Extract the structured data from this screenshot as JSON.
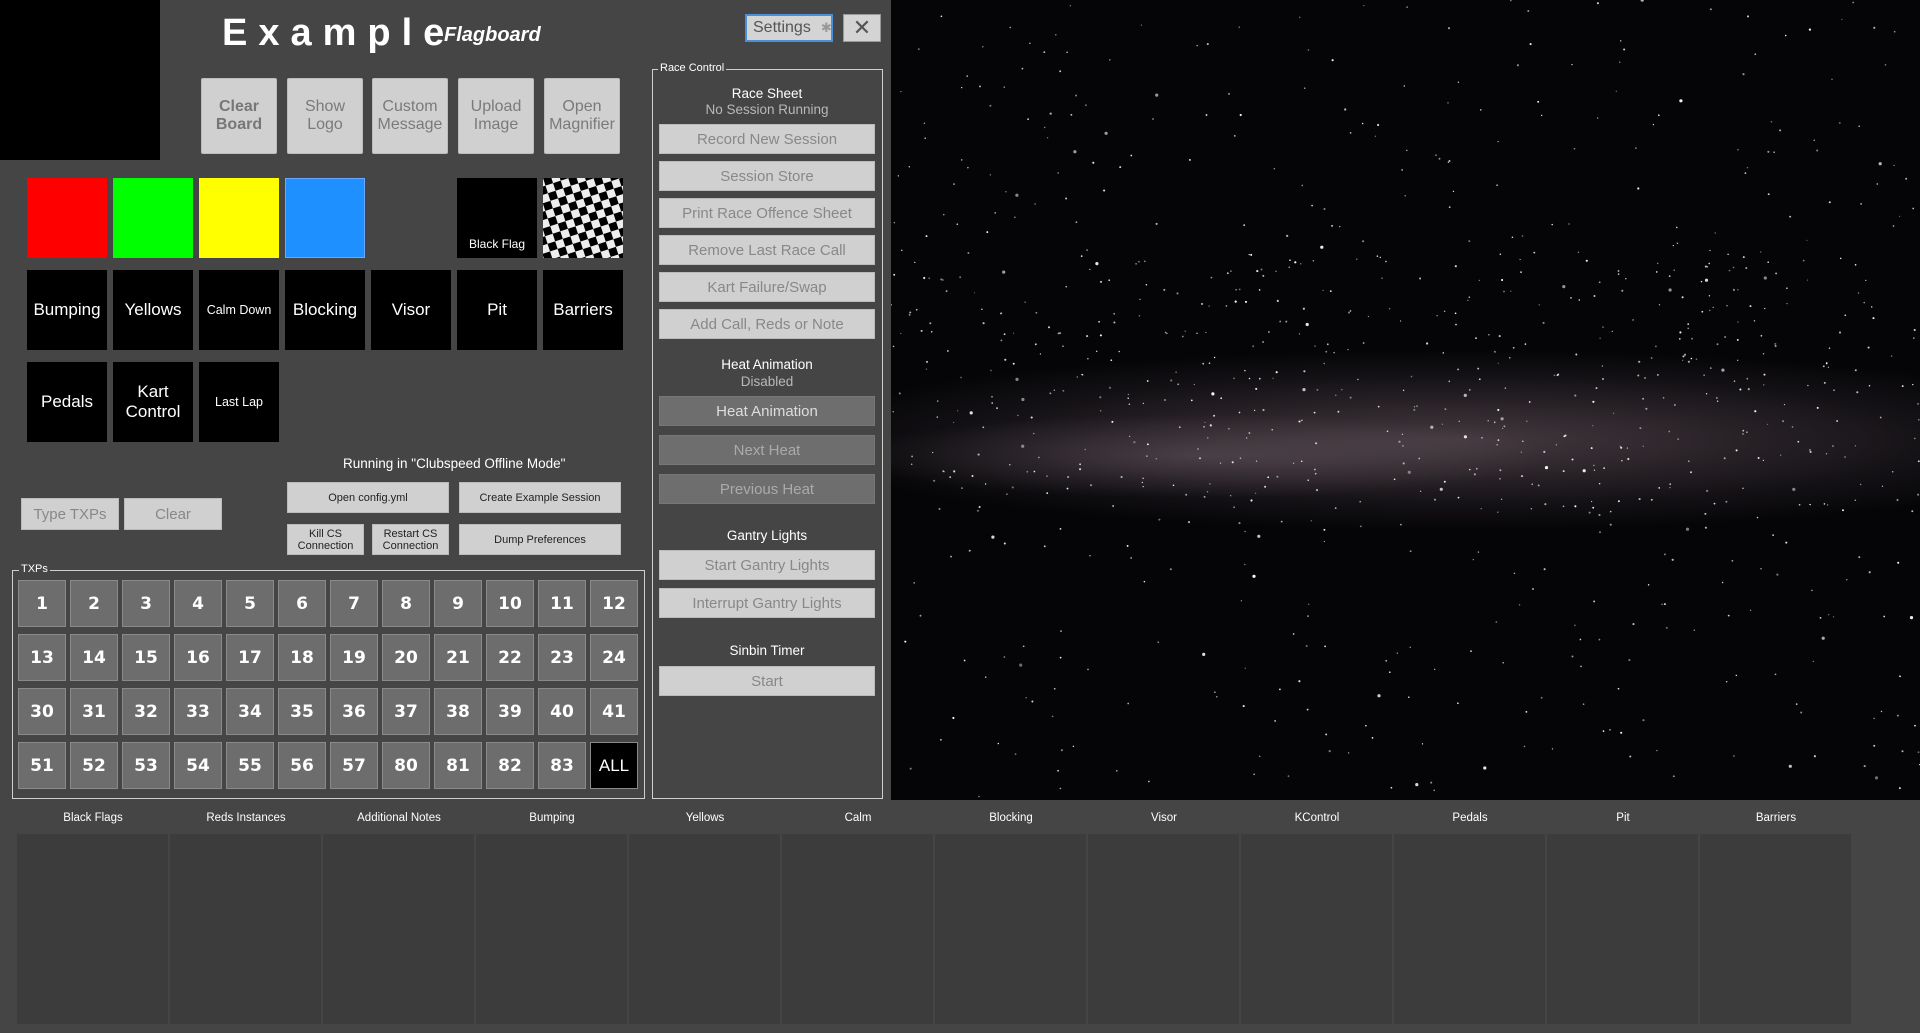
{
  "header": {
    "title": "Example",
    "subtitle": "Flagboard"
  },
  "window": {
    "settings_label": "Settings",
    "close_label": "✕"
  },
  "top_buttons": [
    {
      "label": "Clear\nBoard"
    },
    {
      "label": "Show\nLogo"
    },
    {
      "label": "Custom\nMessage"
    },
    {
      "label": "Upload\nImage"
    },
    {
      "label": "Open\nMagnifier"
    }
  ],
  "flags": {
    "colors": [
      "#ff0000",
      "#00ff00",
      "#ffff00",
      "#1e90ff"
    ],
    "black_flag_label": "Black Flag"
  },
  "message_tiles": [
    "Bumping",
    "Yellows",
    "Calm Down",
    "Blocking",
    "Visor",
    "Pit",
    "Barriers",
    "Pedals",
    "Kart\nControl",
    "Last Lap"
  ],
  "status": {
    "mode_text": "Running in \"Clubspeed Offline Mode\""
  },
  "txp_input": {
    "placeholder": "Type TXPs",
    "clear_label": "Clear"
  },
  "utility_buttons": {
    "open_config": "Open config.yml",
    "create_example": "Create Example Session",
    "kill_cs": "Kill CS\nConnection",
    "restart_cs": "Restart CS\nConnection",
    "dump_prefs": "Dump Preferences"
  },
  "txps": {
    "group_label": "TXPs",
    "numbers": [
      "1",
      "2",
      "3",
      "4",
      "5",
      "6",
      "7",
      "8",
      "9",
      "10",
      "11",
      "12",
      "13",
      "14",
      "15",
      "16",
      "17",
      "18",
      "19",
      "20",
      "21",
      "22",
      "23",
      "24",
      "30",
      "31",
      "32",
      "33",
      "34",
      "35",
      "36",
      "37",
      "38",
      "39",
      "40",
      "41",
      "51",
      "52",
      "53",
      "54",
      "55",
      "56",
      "57",
      "80",
      "81",
      "82",
      "83",
      "ALL"
    ]
  },
  "race_control": {
    "group_label": "Race Control",
    "race_sheet": {
      "heading": "Race Sheet",
      "status": "No Session Running",
      "buttons": [
        "Record New Session",
        "Session Store",
        "Print Race Offence Sheet",
        "Remove Last Race Call",
        "Kart Failure/Swap",
        "Add Call, Reds or Note"
      ]
    },
    "heat_animation": {
      "heading": "Heat Animation",
      "status": "Disabled",
      "buttons": [
        "Heat Animation",
        "Next Heat",
        "Previous Heat"
      ]
    },
    "gantry": {
      "heading": "Gantry Lights",
      "buttons": [
        "Start Gantry Lights",
        "Interrupt Gantry Lights"
      ]
    },
    "sinbin": {
      "heading": "Sinbin Timer",
      "button": "Start"
    }
  },
  "notes_columns": [
    "Black Flags",
    "Reds Instances",
    "Additional Notes",
    "Bumping",
    "Yellows",
    "Calm",
    "Blocking",
    "Visor",
    "KControl",
    "Pedals",
    "Pit",
    "Barriers"
  ]
}
